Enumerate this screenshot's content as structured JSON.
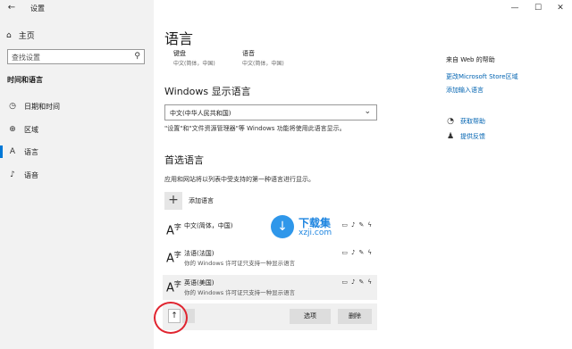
{
  "window": {
    "title": "设置",
    "back_icon": "←",
    "minimize": "—",
    "maximize": "☐",
    "close": "✕"
  },
  "sidebar": {
    "home_label": "主页",
    "search_placeholder": "查找设置",
    "section_heading": "时间和语言",
    "items": [
      {
        "label": "日期和时间",
        "icon": "calendar-clock-icon"
      },
      {
        "label": "区域",
        "icon": "globe-icon"
      },
      {
        "label": "语言",
        "icon": "language-icon",
        "active": true
      },
      {
        "label": "语音",
        "icon": "microphone-icon"
      }
    ]
  },
  "main": {
    "title": "语言",
    "keyboard": {
      "label": "键盘",
      "value": "中文(简体，中国)"
    },
    "speech": {
      "label": "语音",
      "value": "中文(简体，中国)"
    },
    "display_language": {
      "heading": "Windows 显示语言",
      "selected": "中文(中华人民共和国)",
      "description": "\"设置\"和\"文件资源管理器\"等 Windows 功能将使用此语言显示。"
    },
    "preferred": {
      "heading": "首选语言",
      "description": "应用和网站将以列表中受支持的第一种语言进行显示。",
      "add_label": "添加语言",
      "languages": [
        {
          "name": "中文(简体，中国)",
          "sub": ""
        },
        {
          "name": "法语(法国)",
          "sub": "你的 Windows 许可证只支持一种显示语言"
        },
        {
          "name": "英语(美国)",
          "sub": "你的 Windows 许可证只支持一种显示语言",
          "selected": true
        }
      ],
      "options_button": "选项",
      "remove_button": "删除"
    }
  },
  "right": {
    "help_title": "来自 Web 的帮助",
    "links": [
      "更改Microsoft Store区域",
      "添加输入语言"
    ],
    "get_help": "获取帮助",
    "feedback": "提供反馈"
  },
  "watermark": {
    "name": "下载集",
    "domain": "xzji.com"
  },
  "colors": {
    "accent": "#0078d7",
    "link": "#0063b1",
    "annotation": "#e0242f"
  }
}
